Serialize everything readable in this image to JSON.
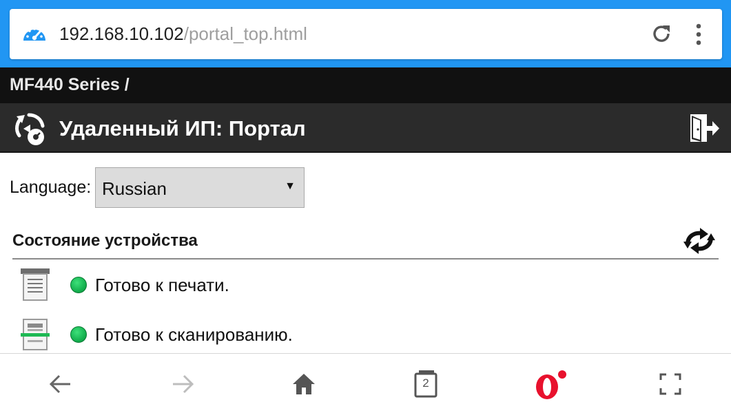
{
  "browser": {
    "url_host": "192.168.10.102",
    "url_path": "/portal_top.html",
    "tabs_count": "2"
  },
  "header": {
    "breadcrumb": "MF440 Series /",
    "title": "Удаленный ИП: Портал"
  },
  "language": {
    "label": "Language:",
    "selected": "Russian"
  },
  "device_status": {
    "heading": "Состояние устройства",
    "items": [
      {
        "icon": "printer-icon",
        "status_color": "#1db954",
        "text": "Готово к печати."
      },
      {
        "icon": "scanner-icon",
        "status_color": "#1db954",
        "text": "Готово к сканированию."
      }
    ]
  },
  "colors": {
    "browser_bar": "#2196f3",
    "breadcrumb_bar": "#111111",
    "title_bar": "#2b2b2b",
    "opera_red": "#e8112d"
  }
}
